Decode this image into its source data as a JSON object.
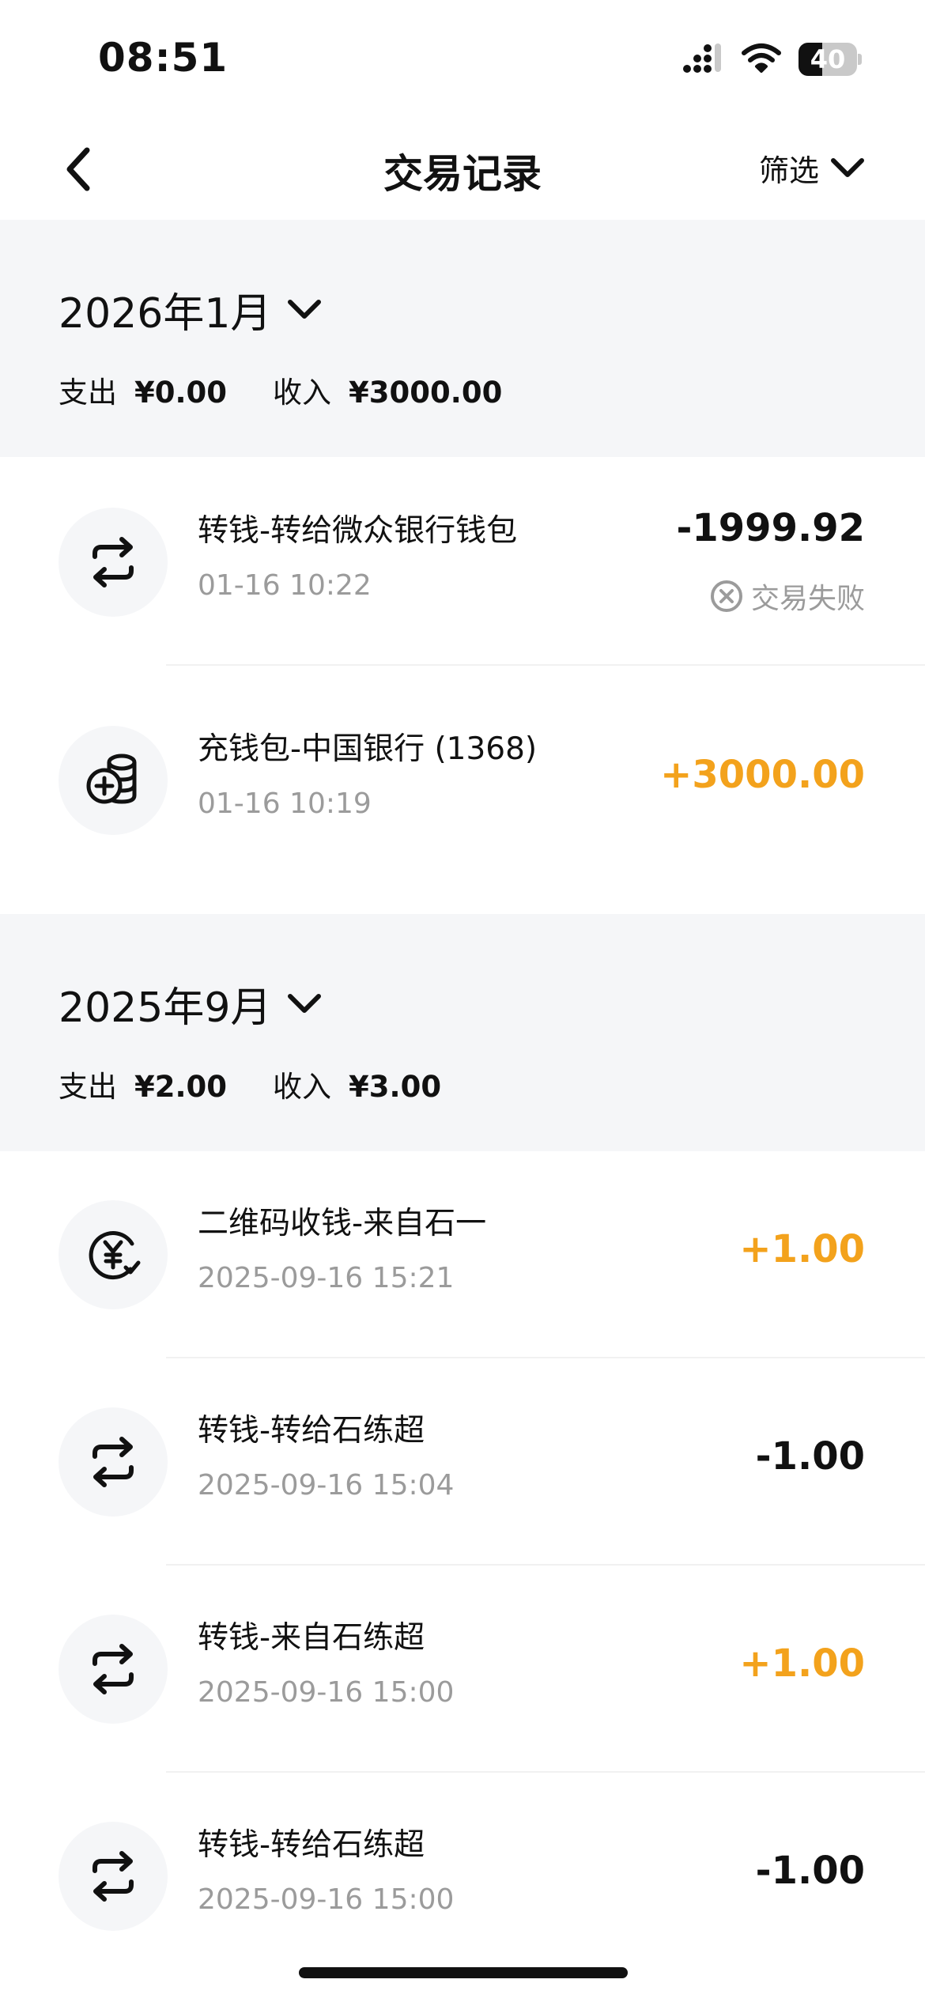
{
  "status_bar": {
    "time": "08:51",
    "battery_level": "40",
    "battery_fraction": 0.4,
    "icons": [
      "signal-icon",
      "wifi-icon",
      "battery-icon"
    ]
  },
  "nav": {
    "back_icon": "chevron-left-icon",
    "title": "交易记录",
    "filter_label": "筛选",
    "filter_icon": "chevron-down-icon"
  },
  "colors": {
    "income": "#f3a21c",
    "expense": "#111111",
    "muted": "#9b9b9b",
    "section_bg": "#f5f6f8"
  },
  "months": [
    {
      "title": "2026年1月",
      "expense_label": "支出",
      "expense_value": "¥0.00",
      "income_label": "收入",
      "income_value": "¥3000.00",
      "transactions": [
        {
          "icon": "transfer-icon",
          "title": "转钱-转给微众银行钱包",
          "time": "01-16 10:22",
          "amount": "-1999.92",
          "type": "expense",
          "status": "交易失败",
          "status_icon": "circle-x-icon"
        },
        {
          "icon": "coin-stack-plus-icon",
          "title": "充钱包-中国银行 (1368)",
          "time": "01-16 10:19",
          "amount": "+3000.00",
          "type": "income"
        }
      ]
    },
    {
      "title": "2025年9月",
      "expense_label": "支出",
      "expense_value": "¥2.00",
      "income_label": "收入",
      "income_value": "¥3.00",
      "transactions": [
        {
          "icon": "qr-receive-yuan-icon",
          "title": "二维码收钱-来自石一",
          "time": "2025-09-16 15:21",
          "amount": "+1.00",
          "type": "income"
        },
        {
          "icon": "transfer-icon",
          "title": "转钱-转给石练超",
          "time": "2025-09-16 15:04",
          "amount": "-1.00",
          "type": "expense"
        },
        {
          "icon": "transfer-icon",
          "title": "转钱-来自石练超",
          "time": "2025-09-16 15:00",
          "amount": "+1.00",
          "type": "income"
        },
        {
          "icon": "transfer-icon",
          "title": "转钱-转给石练超",
          "time": "2025-09-16 15:00",
          "amount": "-1.00",
          "type": "expense"
        }
      ]
    }
  ]
}
